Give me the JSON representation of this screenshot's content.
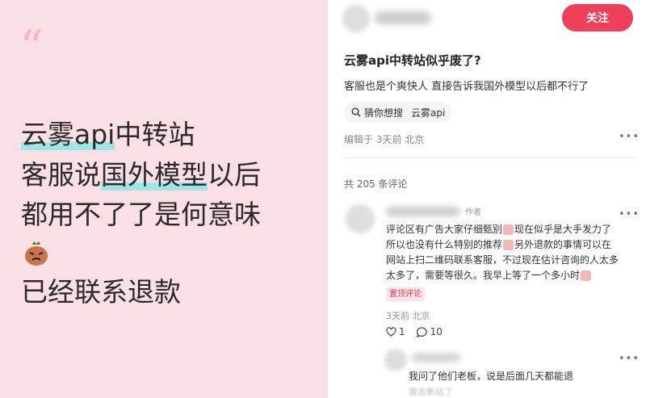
{
  "left_panel": {
    "quote_mark": "“",
    "line1_hl": "云雾api",
    "line1_rest": "中转站",
    "line2_a": "客服说",
    "line2_hl": "国外模型",
    "line2_b": "以后",
    "line3": "都用不了了是何意味",
    "line5": "已经联系退款",
    "emoji_name": "bag-face-emoji"
  },
  "post": {
    "follow_label": "关注",
    "title": "云雾api中转站似乎废了?",
    "body": "客服也是个爽快人 直接告诉我国外模型以后都不行了",
    "search_label": "猜你想搜",
    "search_term": "云雾api",
    "meta": "编辑于 3天前 北京"
  },
  "comments": {
    "count_label": "共 205 条评论",
    "author_tag": "作者",
    "lines": [
      "评论区有广告大家仔细甄别",
      "现在似乎是大手发力了",
      "所以也没有什么特别的推荐",
      "另外退款的事情可以在",
      "网站上扫二维码联系客服，不过现在估计咨询的人太多",
      "太多了，需要等很久。我早上等了一个多小时"
    ],
    "pin_label": "置顶评论",
    "time_location": "3天前 北京",
    "like_count": "1",
    "reply_count": "10",
    "reply_text": "我问了他们老板，说是后面几天都能退",
    "reply_fade": "我去新站了"
  },
  "colors": {
    "accent": "#ef3f5a",
    "highlight": "#9ee6e6",
    "left_bg": "#fadfe4"
  }
}
